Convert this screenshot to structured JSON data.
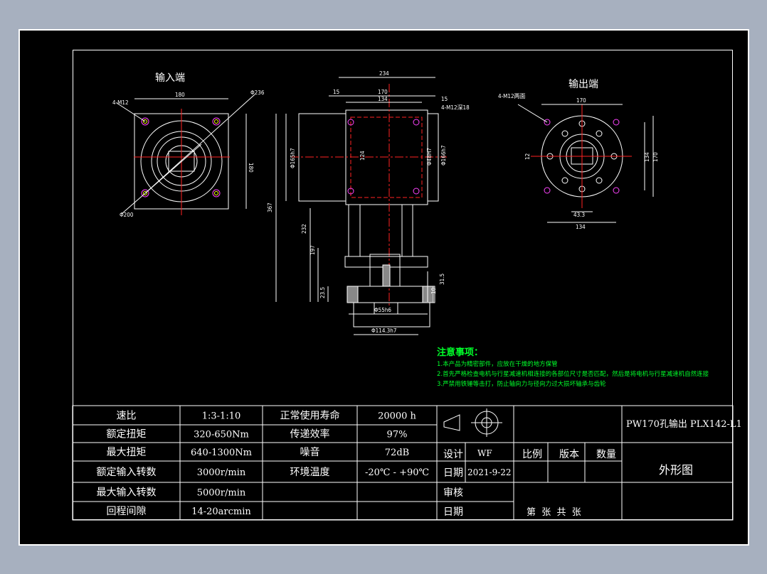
{
  "views": {
    "input_title": "输入端",
    "output_title": "输出端"
  },
  "dims": {
    "in_holes": "4-M12",
    "in_width": "180",
    "in_height": "180",
    "in_diag": "Φ236",
    "in_circle": "Φ200",
    "front_len": "234",
    "front_15a": "15",
    "front_170": "170",
    "front_134": "134",
    "front_15b": "15",
    "front_holes": "4-M12深18",
    "front_d1": "Φ165h7",
    "front_124": "124",
    "front_d2": "Φ48H7",
    "front_d3": "Φ166h7",
    "front_367": "367",
    "front_232": "232",
    "front_197": "197",
    "front_235": "23.5",
    "front_10": "10",
    "front_315": "31.5",
    "front_d4": "Φ55h6",
    "front_d5": "Φ114.3h7",
    "out_holes": "4-M12两面",
    "out_170": "170",
    "out_12": "12",
    "out_134v": "134",
    "out_170v": "170",
    "out_433": "43.3",
    "out_134h": "134"
  },
  "notes": {
    "title": "注意事项：",
    "items": [
      "1.本产品为精密部件，应放在干燥的地方保管",
      "2.首先严格检查电机与行星减速机相连接的各部位尺寸是否匹配，然后是将电机与行星减速机自然连接",
      "3.严禁用铁锤等击打，防止轴向力与径向力过大损坏轴承与齿轮"
    ]
  },
  "specs": [
    {
      "label": "速比",
      "value": "1:3-1:10",
      "label2": "正常使用寿命",
      "value2": "20000 h"
    },
    {
      "label": "额定扭矩",
      "value": "320-650Nm",
      "label2": "传递效率",
      "value2": "97%"
    },
    {
      "label": "最大扭矩",
      "value": "640-1300Nm",
      "label2": "噪音",
      "value2": "72dB"
    },
    {
      "label": "额定输入转数",
      "value": "3000r/min",
      "label2": "环境温度",
      "value2": "-20℃ - +90℃"
    },
    {
      "label": "最大输入转数",
      "value": "5000r/min",
      "label2": "",
      "value2": ""
    },
    {
      "label": "回程间隙",
      "value": "14-20arcmin",
      "label2": "",
      "value2": ""
    }
  ],
  "title_block": {
    "drawing_name": "PW170孔输出 PLX142-L1",
    "design_label": "设计",
    "designer": "WF",
    "scale_label": "比例",
    "version_label": "版本",
    "qty_label": "数量",
    "date_label": "日期",
    "date": "2021-9-22",
    "review_label": "审核",
    "date2_label": "日期",
    "drawing_type": "外形图",
    "sheet_text": "第  张  共  张"
  },
  "colors": {
    "background": "#000000",
    "line": "#ffffff",
    "center": "#ff2222",
    "hole": "#ff44ff",
    "note": "#00ff2a"
  }
}
